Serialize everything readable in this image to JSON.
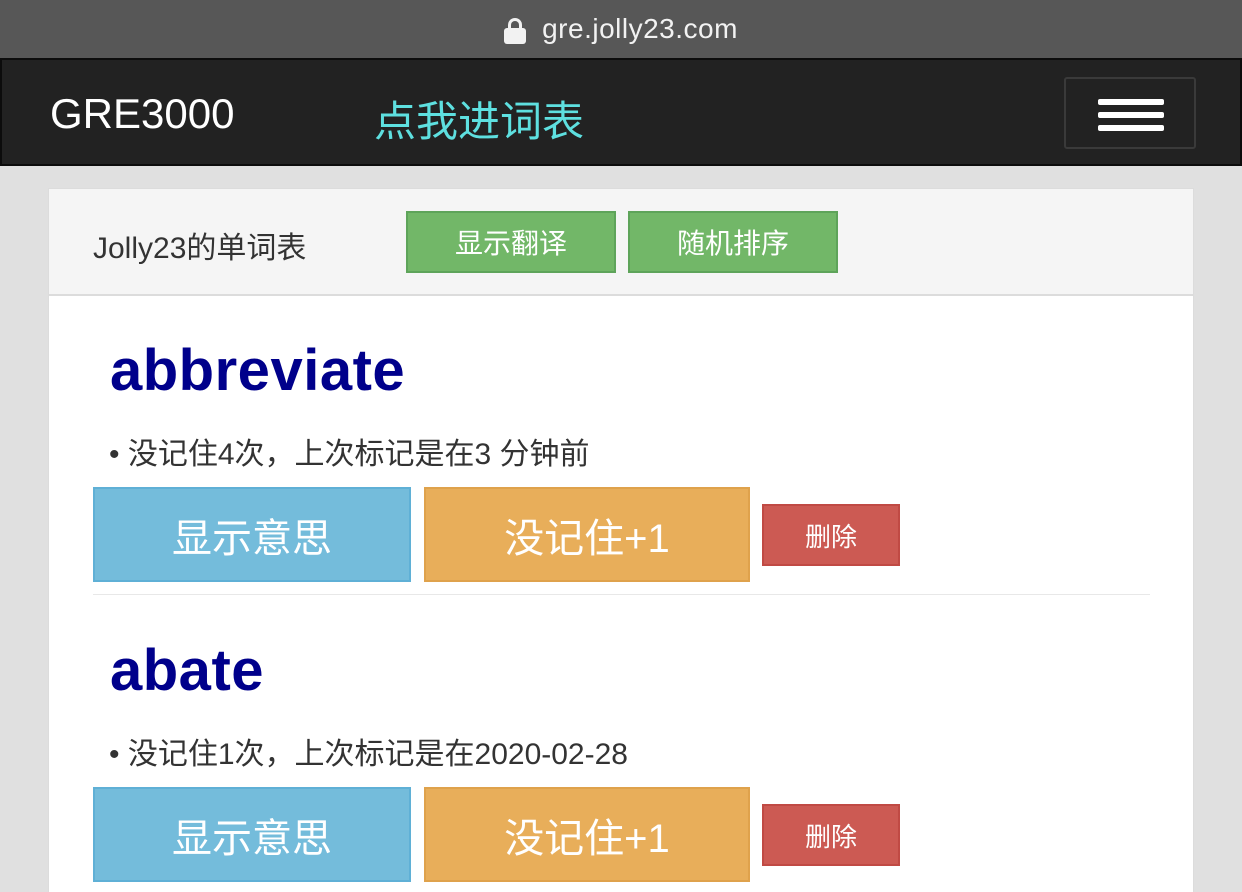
{
  "browser": {
    "url": "gre.jolly23.com",
    "lock_icon": "lock-icon"
  },
  "navbar": {
    "brand": "GRE3000",
    "link": "点我进词表",
    "menu_icon": "hamburger-menu-icon"
  },
  "panel": {
    "title": "Jolly23的单词表",
    "show_translation_label": "显示翻译",
    "shuffle_label": "随机排序"
  },
  "words": [
    {
      "word": "abbreviate",
      "info": "• 没记住4次，上次标记是在3 分钟前",
      "show_meaning": "显示意思",
      "forgot": "没记住+1",
      "delete": "删除"
    },
    {
      "word": "abate",
      "info": "• 没记住1次，上次标记是在2020-02-28",
      "show_meaning": "显示意思",
      "forgot": "没记住+1",
      "delete": "删除"
    }
  ],
  "colors": {
    "navbar_bg": "#222222",
    "link": "#5ee0e0",
    "word": "#00008b",
    "btn_success": "#72b768",
    "btn_info": "#74bcdb",
    "btn_warning": "#e8ae5a",
    "btn_danger": "#cc5a53"
  }
}
